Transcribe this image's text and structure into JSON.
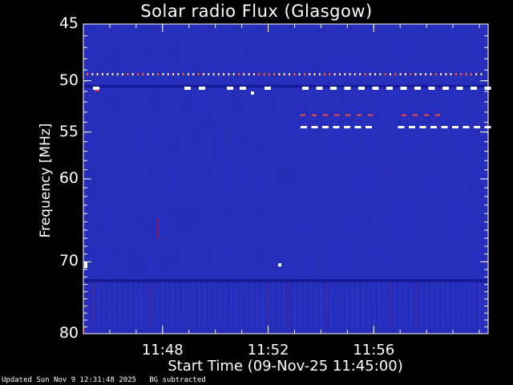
{
  "chart_data": {
    "type": "heatmap",
    "title": "Solar radio Flux (Glasgow)",
    "ylabel": "Frequency [MHz]",
    "xlabel": "Start Time (09-Nov-25 11:45:00)",
    "y_scale": "log",
    "ylim": [
      80,
      45
    ],
    "y_ticks": [
      {
        "value": 45,
        "label": "45"
      },
      {
        "value": 50,
        "label": "50"
      },
      {
        "value": 55,
        "label": "55"
      },
      {
        "value": 60,
        "label": "60"
      },
      {
        "value": 70,
        "label": "70"
      },
      {
        "value": 80,
        "label": "80"
      }
    ],
    "xlim": [
      "11:45:00",
      "12:00:20"
    ],
    "x_ticks": [
      {
        "value": "11:48",
        "label": "11:48"
      },
      {
        "value": "11:52",
        "label": "11:52"
      },
      {
        "value": "11:56",
        "label": "11:56"
      }
    ],
    "colors": {
      "background": "#1a1ea8",
      "frame": "#ffffff",
      "rfi": "#ffffff",
      "hot": "#d01010"
    },
    "grid": false
  },
  "footer": {
    "updated": "Updated Sun Nov  9 12:31:48 2025",
    "note": "BG subtracted"
  }
}
